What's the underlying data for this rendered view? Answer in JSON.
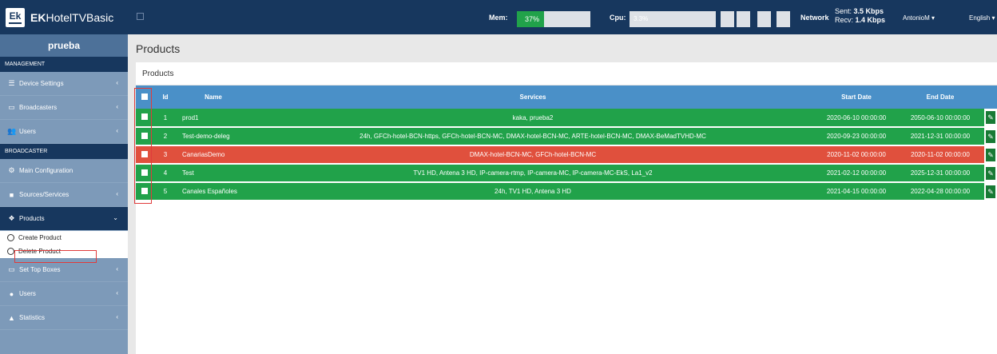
{
  "app": {
    "brand_prefix": "EK",
    "brand_suffix": "HotelTVBasic",
    "logo_text": "Ek"
  },
  "topbar": {
    "mem_label": "Mem:",
    "mem_value": "37%",
    "mem_fraction": 0.37,
    "cpu_label": "Cpu:",
    "cpu_value": "3.3%",
    "network_label": "Network",
    "sent_label": "Sent:",
    "sent_value": "3.5 Kbps",
    "recv_label": "Recv:",
    "recv_value": "1.4 Kbps",
    "user": "AntonioM ▾",
    "language": "English ▾"
  },
  "sidebar": {
    "title": "prueba",
    "management_header": "MANAGEMENT",
    "device_settings": "Device Settings",
    "broadcasters": "Broadcasters",
    "users": "Users",
    "broadcaster_header": "BROADCASTER",
    "main_configuration": "Main Configuration",
    "sources_services": "Sources/Services",
    "products": "Products",
    "create_product": "Create Product",
    "delete_product": "Delete Product",
    "set_top_boxes": "Set Top Boxes",
    "users2": "Users",
    "statistics": "Statistics"
  },
  "main": {
    "page_title": "Products",
    "panel_title": "Products",
    "columns": {
      "id": "Id",
      "name": "Name",
      "services": "Services",
      "start": "Start Date",
      "end": "End Date"
    },
    "rows": [
      {
        "id": "1",
        "name": "prod1",
        "services": "kaka, prueba2",
        "start": "2020-06-10 00:00:00",
        "end": "2050-06-10 00:00:00",
        "status": "green"
      },
      {
        "id": "2",
        "name": "Test-demo-deleg",
        "services": "24h, GFCh-hotel-BCN-https, GFCh-hotel-BCN-MC, DMAX-hotel-BCN-MC, ARTE-hotel-BCN-MC, DMAX-BeMadTVHD-MC",
        "start": "2020-09-23 00:00:00",
        "end": "2021-12-31 00:00:00",
        "status": "green"
      },
      {
        "id": "3",
        "name": "CanariasDemo",
        "services": "DMAX-hotel-BCN-MC, GFCh-hotel-BCN-MC",
        "start": "2020-11-02 00:00:00",
        "end": "2020-11-02 00:00:00",
        "status": "red"
      },
      {
        "id": "4",
        "name": "Test",
        "services": "TV1 HD, Antena 3 HD, IP-camera-rtmp, IP-camera-MC, IP-camera-MC-EkS, La1_v2",
        "start": "2021-02-12 00:00:00",
        "end": "2025-12-31 00:00:00",
        "status": "green"
      },
      {
        "id": "5",
        "name": "Canales Españoles",
        "services": "24h, TV1 HD, Antena 3 HD",
        "start": "2021-04-15 00:00:00",
        "end": "2022-04-28 00:00:00",
        "status": "green"
      }
    ]
  },
  "icons": {
    "bars": "bars-icon",
    "monitor": "monitor-icon",
    "users": "users-icon",
    "cogs": "cogs-icon",
    "video": "video-icon",
    "cubes": "cubes-icon",
    "box": "box-icon",
    "user": "user-icon",
    "chart": "chart-icon",
    "edit": "edit-icon"
  },
  "colors": {
    "topbar": "#17375e",
    "green": "#21a24a",
    "red": "#e0503d",
    "header": "#4a90c8"
  }
}
